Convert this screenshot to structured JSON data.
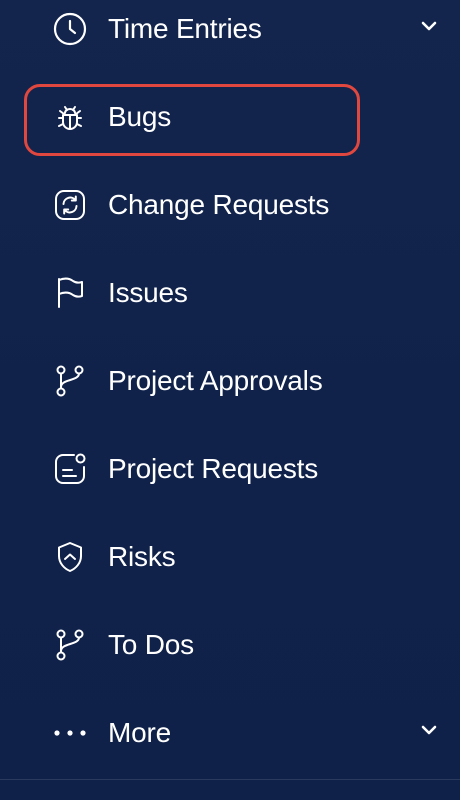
{
  "sidebar": {
    "items": [
      {
        "label": "Time Entries",
        "icon": "clock-icon",
        "expandable": true
      },
      {
        "label": "Bugs",
        "icon": "bug-icon",
        "highlighted": true
      },
      {
        "label": "Change Requests",
        "icon": "refresh-square-icon"
      },
      {
        "label": "Issues",
        "icon": "flag-icon"
      },
      {
        "label": "Project Approvals",
        "icon": "git-branch-icon"
      },
      {
        "label": "Project Requests",
        "icon": "message-notification-icon"
      },
      {
        "label": "Risks",
        "icon": "shield-chevron-icon"
      },
      {
        "label": "To Dos",
        "icon": "git-branch-icon"
      },
      {
        "label": "More",
        "icon": "more-dots-icon",
        "expandable": true
      }
    ]
  },
  "colors": {
    "background": "#0f2148",
    "text": "#ffffff",
    "highlight_border": "#e0473e"
  }
}
